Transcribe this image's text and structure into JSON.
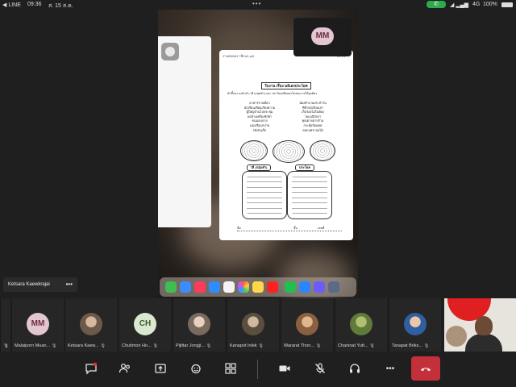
{
  "status_bar": {
    "back_app": "◀ LINE",
    "time": "09:36",
    "date": "ส. 15 ส.ค.",
    "network": "4G",
    "battery": "100%"
  },
  "document": {
    "filename": "งานพบคดงา.ฝึกแถ.pdf",
    "toolbar_done": "เสร็จ",
    "title": "ใบงาน เรื่อง ฉลิเลงประโยค",
    "instructions": "คำชี้แจง จงนำคำ-วลี (กลุ่มคำ) และ ประโยคเขียนลงในช่องว่างให้ถูกต้อง",
    "words_left": [
      "อาหารรายเดียว",
      "นักเรียนเขียนเรียงความ",
      "ผู้ใหญ่บ้านไปประชุม",
      "พ่อล้างเครื่องซักผ้า",
      "ขนมอบบ่าย",
      "แตงเรื่อแก่ปาย",
      "รยังกันเร็ก"
    ],
    "words_right": [
      "น้องทำงานประจำวัน",
      "ที่ทำนักเรียนเล่า",
      "เก็บร่องไม่ในห้อง",
      "วยแบนีกับรา",
      "คุณตาขยาบร้าน",
      "กระทุ้งป้อนคต",
      "ดอกบทรายนไม้"
    ],
    "box_left_label": "วลี (กลุ่มคำ)",
    "box_right_label": "ประโยค",
    "footer_name": "ชื่อ",
    "footer_class": "ชั้น",
    "footer_number": "เลขที่"
  },
  "self_avatar": {
    "initials": "MM"
  },
  "pinned_name": {
    "name": "Ketsara Kaewkrajai",
    "more": "•••"
  },
  "participants": [
    {
      "name": "",
      "initials": "",
      "color": "#444444"
    },
    {
      "name": "Malaiporn Muan...",
      "initials": "MM",
      "color": "#e3c6cf"
    },
    {
      "name": "Ketsara Kaew...",
      "initials": "",
      "color": "#6b5a4a"
    },
    {
      "name": "Chutimon Ho...",
      "initials": "CH",
      "color": "#d9e8cf"
    },
    {
      "name": "Pijittar Jongji...",
      "initials": "",
      "color": "#7a6a5e"
    },
    {
      "name": "Kanapot Inlek",
      "initials": "",
      "color": "#5a4e3e"
    },
    {
      "name": "Wararat Thon...",
      "initials": "",
      "color": "#8a6040"
    },
    {
      "name": "Chaninat Yutt...",
      "initials": "",
      "color": "#5f7a3a"
    },
    {
      "name": "Tanapat Briks...",
      "initials": "",
      "color": "#2f5fa0"
    }
  ],
  "toolbar": {
    "chat": "chat-icon",
    "participants": "people-icon",
    "share": "share-screen-icon",
    "reactions": "reaction-icon",
    "apps": "apps-icon",
    "camera": "camera-icon",
    "mic": "mic-muted-icon",
    "audio": "headphones-icon",
    "more": "•••",
    "end": "end-call-icon"
  },
  "colors": {
    "end_call": "#c4303a",
    "call_pill": "#2eaa4a",
    "accent": "#2a6fd6"
  }
}
